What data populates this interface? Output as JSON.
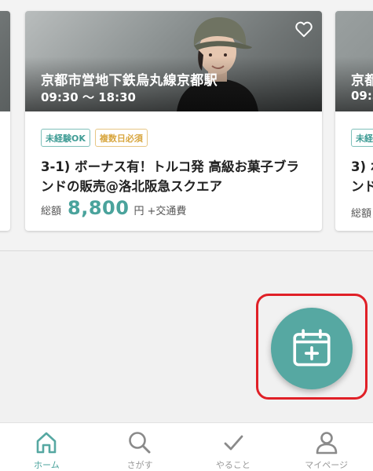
{
  "cards": [
    {
      "station": "",
      "hours": "",
      "tags": []
    },
    {
      "station": "京都市営地下鉄烏丸線京都駅",
      "hours": "09:30 〜 18:30",
      "tags": [
        {
          "label": "未経験OK",
          "style": "green"
        },
        {
          "label": "複数日必須",
          "style": "orange"
        }
      ],
      "title": "3-1) ボーナス有！トルコ発 高級お菓子ブランドの販売@洛北阪急スクエア",
      "wage": {
        "label": "総額",
        "amount": "8,800",
        "unit": "円",
        "extra": "+交通費"
      }
    },
    {
      "station": "京都",
      "hours": "09:3",
      "tags": [
        {
          "label": "未経",
          "style": "green"
        }
      ],
      "title": "3) ボ\nンド",
      "wage": {
        "label": "総額"
      }
    }
  ],
  "fab": {
    "icon": "calendar-plus-icon"
  },
  "bottom_nav": [
    {
      "label": "ホーム",
      "icon": "home-icon",
      "active": true
    },
    {
      "label": "さがす",
      "icon": "search-icon",
      "active": false
    },
    {
      "label": "やること",
      "icon": "check-icon",
      "active": false
    },
    {
      "label": "マイページ",
      "icon": "person-icon",
      "active": false
    }
  ],
  "colors": {
    "accent": "#56a8a2",
    "highlight": "#e02027",
    "tag_green": "#3f9c95",
    "tag_orange": "#d8a63e"
  }
}
